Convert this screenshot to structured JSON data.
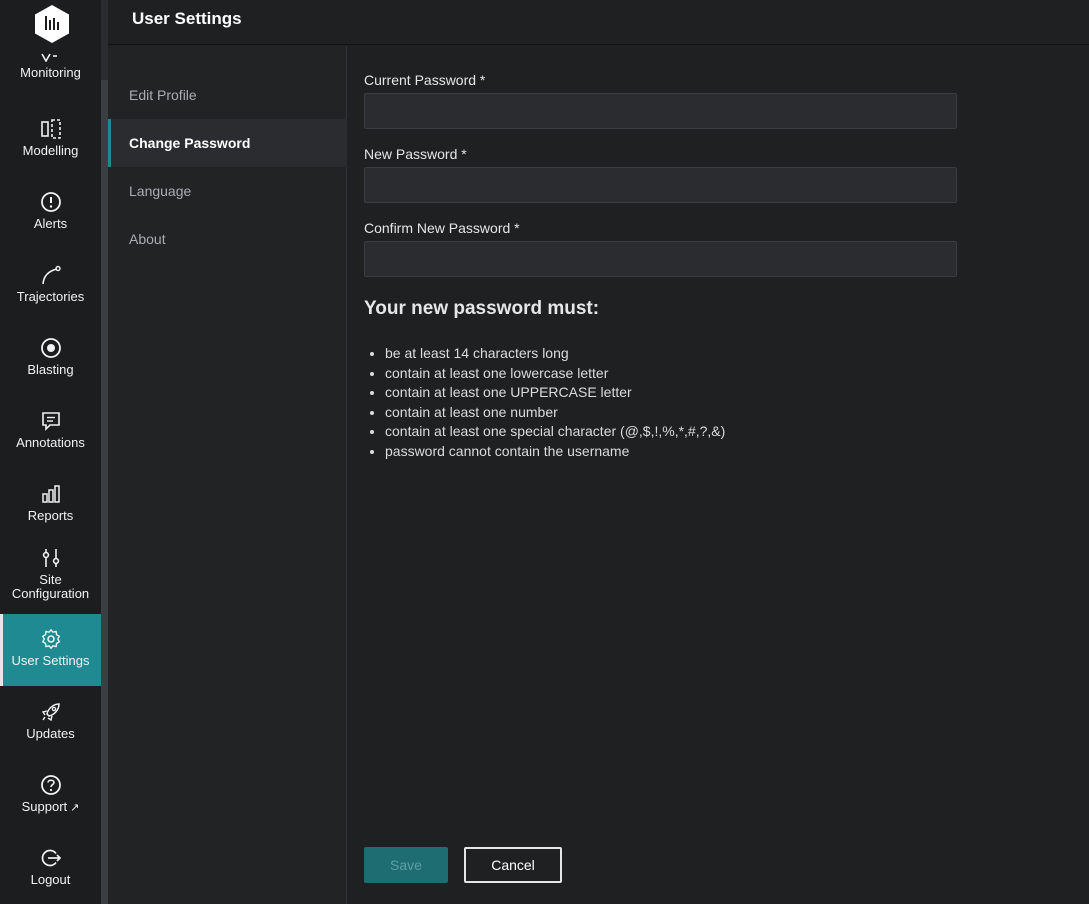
{
  "header": {
    "title": "User Settings"
  },
  "nav": {
    "monitoring": "Monitoring",
    "modelling": "Modelling",
    "alerts": "Alerts",
    "trajectories": "Trajectories",
    "blasting": "Blasting",
    "annotations": "Annotations",
    "reports": "Reports",
    "site_configuration_1": "Site",
    "site_configuration_2": "Configuration",
    "user_settings": "User Settings",
    "updates": "Updates",
    "support": "Support",
    "logout": "Logout"
  },
  "submenu": {
    "items": [
      {
        "label": "Edit Profile"
      },
      {
        "label": "Change Password"
      },
      {
        "label": "Language"
      },
      {
        "label": "About"
      }
    ]
  },
  "form": {
    "current_password_label": "Current Password *",
    "new_password_label": "New Password *",
    "confirm_password_label": "Confirm New Password *",
    "current_password_value": "",
    "new_password_value": "",
    "confirm_password_value": ""
  },
  "rules": {
    "title": "Your new password must:",
    "items": [
      "be at least 14 characters long",
      "contain at least one lowercase letter",
      "contain at least one UPPERCASE letter",
      "contain at least one number",
      "contain at least one special character (@,$,!,%,*,#,?,&)",
      "password cannot contain the username"
    ]
  },
  "buttons": {
    "save": "Save",
    "cancel": "Cancel"
  },
  "colors": {
    "accent": "#1f8a91",
    "background": "#1f2022",
    "field": "#2a2c2f"
  }
}
